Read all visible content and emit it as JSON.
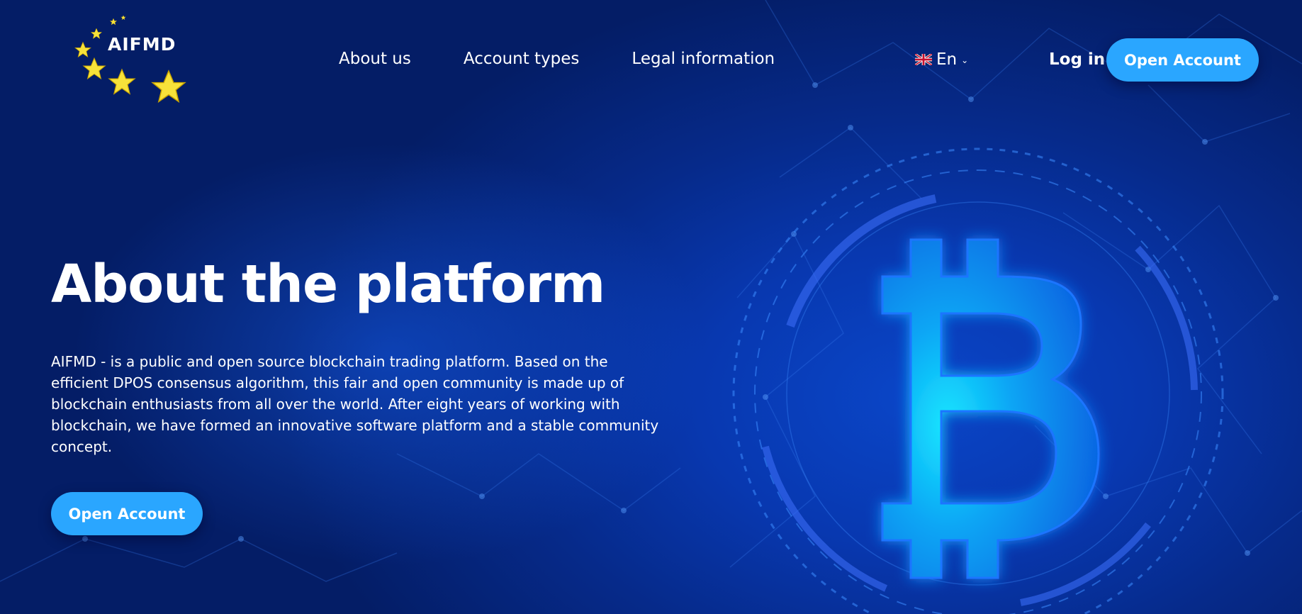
{
  "brand": {
    "name": "AIFMD",
    "logo_icon": "eu-stars-icon"
  },
  "nav": {
    "items": [
      {
        "label": "About us"
      },
      {
        "label": "Account types"
      },
      {
        "label": "Legal information"
      }
    ]
  },
  "language": {
    "selected": "En",
    "flag_icon": "uk-flag-icon",
    "chevron_icon": "chevron-down-icon"
  },
  "auth": {
    "login_label": "Log in",
    "open_account_label": "Open Account"
  },
  "hero": {
    "title": "About the platform",
    "description": "AIFMD - is a public and open source blockchain trading platform. Based on the efficient DPOS consensus algorithm, this fair and open community is made up of blockchain enthusiasts from all over the world. After eight years of working with blockchain, we have formed an innovative software platform and a stable community concept.",
    "cta_label": "Open Account",
    "illustration_icon": "bitcoin-icon"
  },
  "colors": {
    "accent": "#2aa6ff",
    "background_dark": "#041d66",
    "background_mid": "#0838b0",
    "star": "#f7e23a"
  }
}
